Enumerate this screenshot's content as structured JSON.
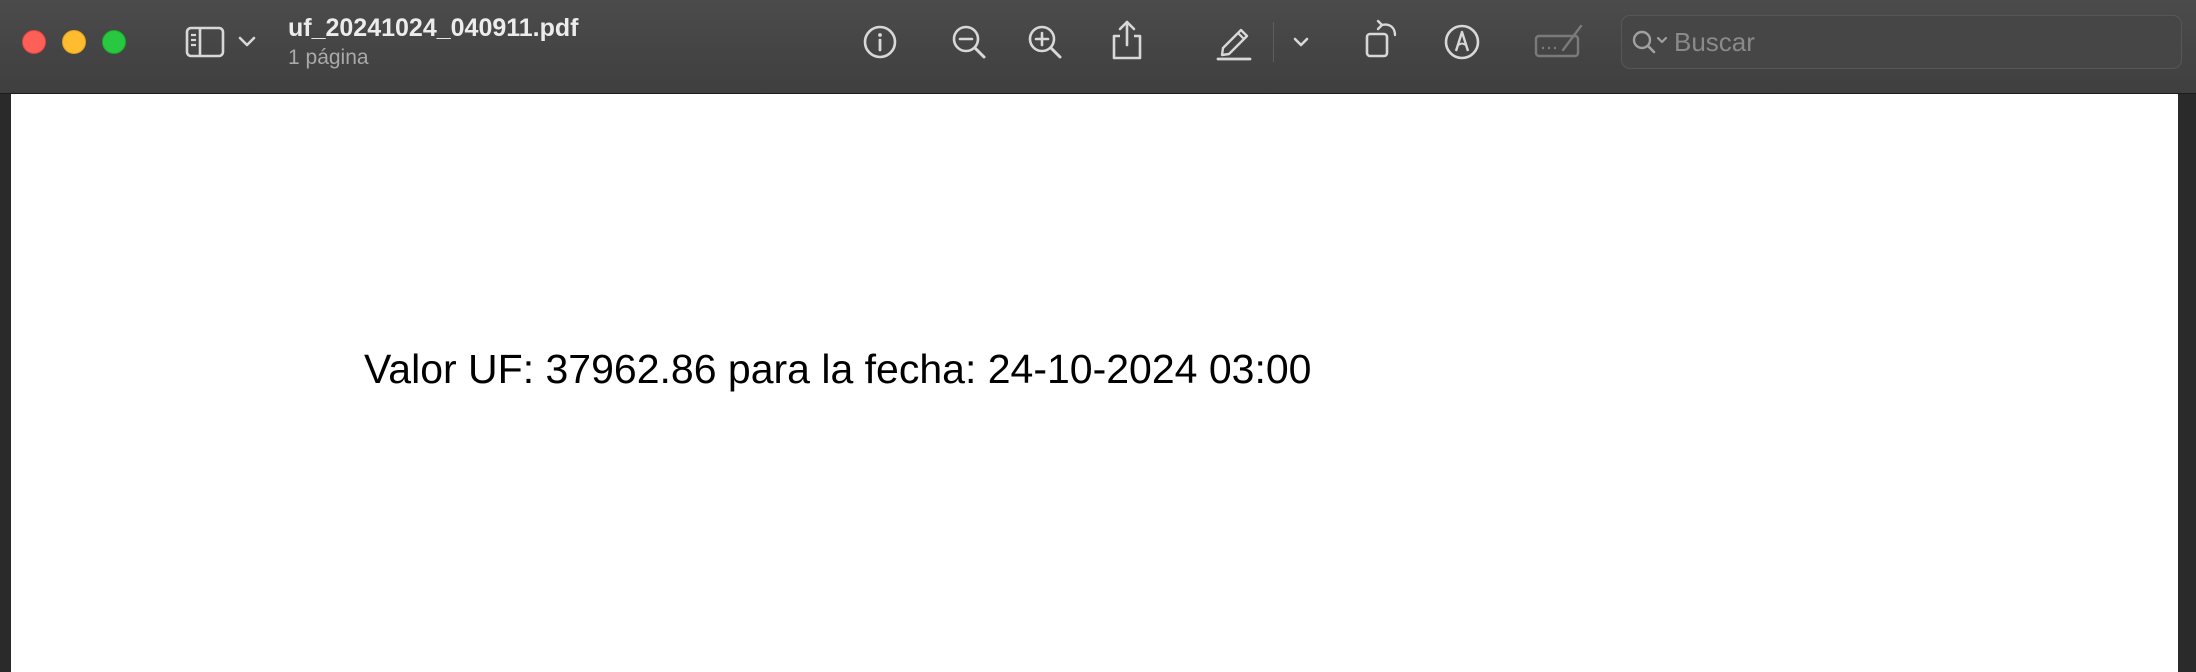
{
  "window": {
    "title": "uf_20241024_040911.pdf",
    "subtitle": "1 página",
    "traffic_lights": {
      "close_color": "#fe5f57",
      "minimize_color": "#febc2e",
      "maximize_color": "#28c840"
    }
  },
  "toolbar": {
    "icons": [
      "sidebar-icon",
      "chevron-down-icon",
      "info-icon",
      "zoom-out-icon",
      "zoom-in-icon",
      "share-icon",
      "highlight-pen-icon",
      "chevron-down-icon",
      "rotate-icon",
      "markup-icon",
      "form-fill-icon"
    ],
    "search": {
      "placeholder": "Buscar",
      "value": ""
    }
  },
  "document": {
    "text": "Valor UF: 37962.86 para la fecha: 24-10-2024 03:00"
  },
  "colors": {
    "titlebar": "#444444",
    "icon": "#d8d8d8",
    "icon_disabled": "#7a7a7a",
    "page": "#ffffff"
  }
}
